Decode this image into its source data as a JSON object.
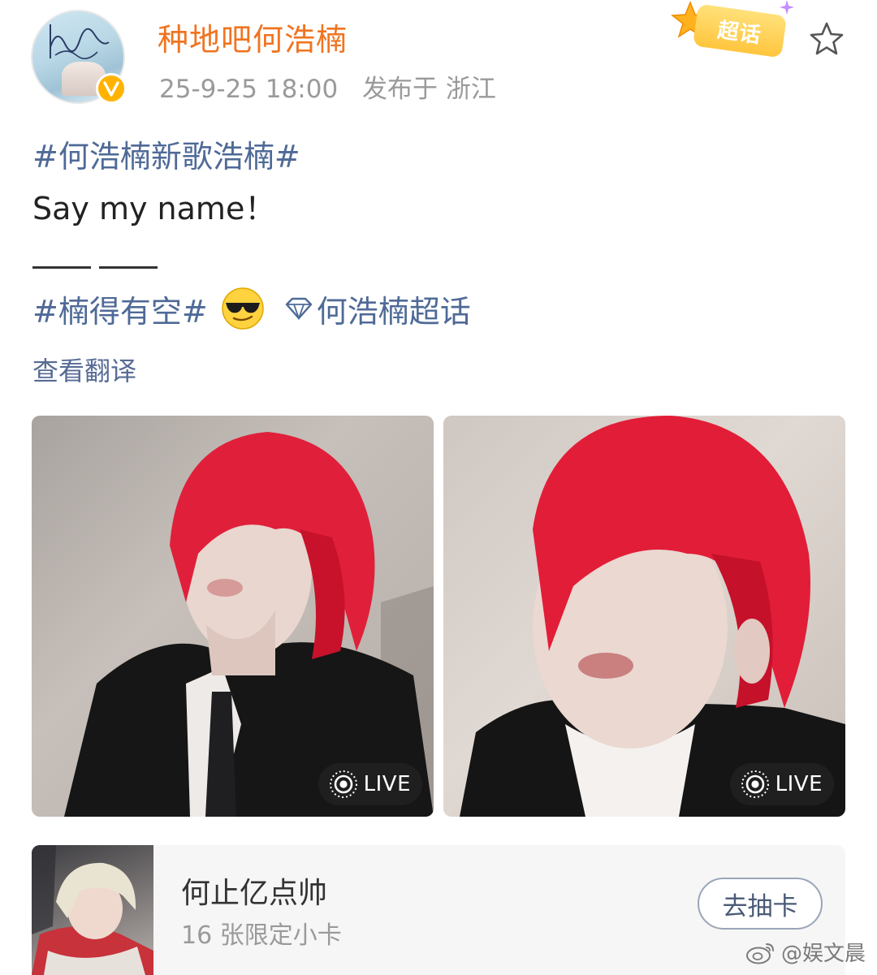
{
  "post": {
    "author_name": "种地吧何浩楠",
    "timestamp": "25-9-25 18:00",
    "location": "发布于 浙江",
    "topic_badge_label": "超话",
    "hashtag_song": "#何浩楠新歌浩楠#",
    "body_line": "Say my name！",
    "hashtag_free": "#楠得有空#",
    "emoji": "sunglasses-emoji",
    "supertopic_link": "何浩楠超话",
    "translate_link": "查看翻译"
  },
  "photos": [
    {
      "live_label": "LIVE"
    },
    {
      "live_label": "LIVE"
    }
  ],
  "card": {
    "title": "何止亿点帅",
    "subtitle": "16 张限定小卡",
    "action_label": "去抽卡"
  },
  "watermark": {
    "text": "@娱文晨"
  },
  "icons": {
    "verified": "verified-v-icon",
    "favorite": "star-outline-icon",
    "supertopic": "diamond-icon",
    "live": "live-photo-icon",
    "weibo": "weibo-logo-icon"
  },
  "colors": {
    "author": "#f07421",
    "link": "#4f6a97",
    "meta": "#9a9a9a",
    "badge": "#ffc53d"
  }
}
